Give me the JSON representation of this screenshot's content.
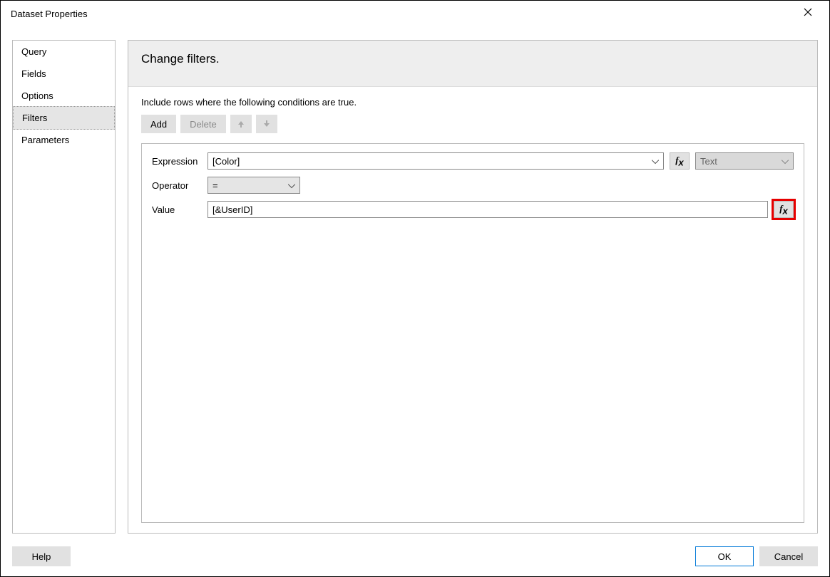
{
  "window": {
    "title": "Dataset Properties"
  },
  "sidebar": {
    "items": [
      {
        "label": "Query"
      },
      {
        "label": "Fields"
      },
      {
        "label": "Options"
      },
      {
        "label": "Filters",
        "selected": true
      },
      {
        "label": "Parameters"
      }
    ]
  },
  "main": {
    "heading": "Change filters.",
    "instruction": "Include rows where the following conditions are true.",
    "toolbar": {
      "add": "Add",
      "delete": "Delete"
    },
    "filter": {
      "labels": {
        "expression": "Expression",
        "operator": "Operator",
        "value": "Value"
      },
      "expression": {
        "value": "[Color]",
        "type": "Text"
      },
      "operator": {
        "value": "="
      },
      "value": {
        "value": "[&UserID]"
      }
    }
  },
  "footer": {
    "help": "Help",
    "ok": "OK",
    "cancel": "Cancel"
  }
}
